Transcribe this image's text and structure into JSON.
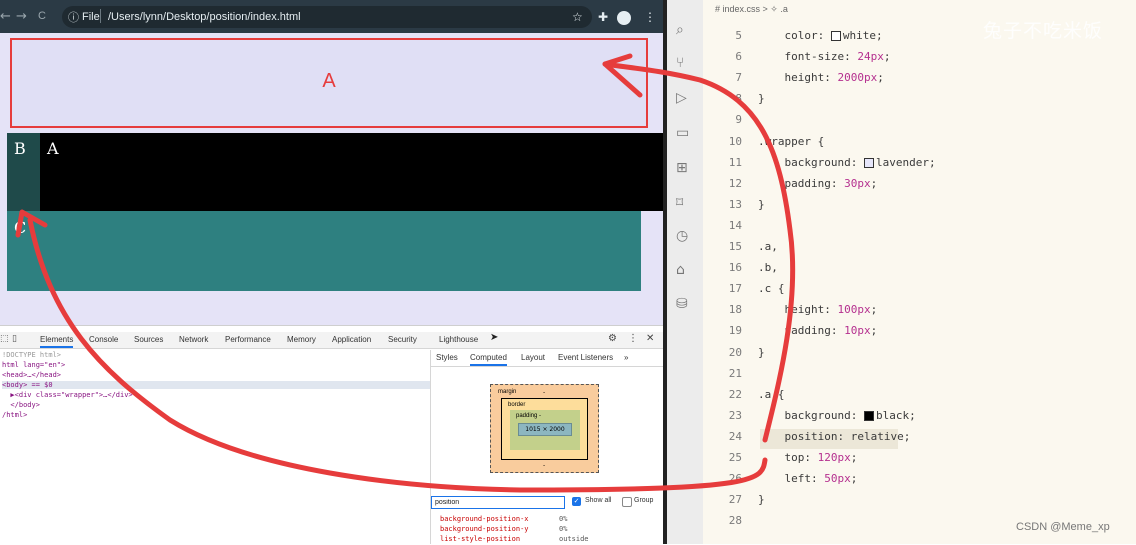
{
  "browser": {
    "nav_back": "←",
    "nav_forward": "→",
    "nav_reload": "C",
    "info_icon": "ⓘ",
    "file_label": "File",
    "url": "/Users/lynn/Desktop/position/index.html",
    "icons": [
      "star-icon",
      "extension-icon",
      "profile-icon",
      "more-icon"
    ]
  },
  "page": {
    "box_a_label": "A",
    "box_b_label": "B",
    "box_a2_label": "A",
    "box_c_label": "C"
  },
  "devtools": {
    "tabs": [
      "Elements",
      "Console",
      "Sources",
      "Network",
      "Performance",
      "Memory",
      "Application",
      "Security",
      "Lighthouse"
    ],
    "dom_lines": [
      "!DOCTYPE html>",
      "html lang=\"en\">",
      "<head>…</head>",
      "<body> == $0",
      "  ▶<div class=\"wrapper\">…</div>",
      "  </body>",
      "/html>"
    ],
    "styles_tabs": [
      "Styles",
      "Computed",
      "Layout",
      "Event Listeners",
      "»"
    ],
    "box_model": {
      "margin_label": "margin",
      "border_label": "border",
      "padding_label": "padding -",
      "content": "1015 × 2000",
      "dash": "-"
    },
    "filter_value": "position",
    "show_all_label": "Show all",
    "group_label": "Group",
    "properties": [
      {
        "name": "background-position-x",
        "value": "0%"
      },
      {
        "name": "background-position-y",
        "value": "0%"
      },
      {
        "name": "list-style-position",
        "value": "outside"
      }
    ]
  },
  "editor": {
    "tab_label": "# index.css > ✧ .a",
    "lines": [
      {
        "n": "5",
        "code": "    color: ",
        "tail": "white;",
        "swatch": "#ffffff"
      },
      {
        "n": "6",
        "code": "    font-size: ",
        "num": "24px",
        ";": ";"
      },
      {
        "n": "7",
        "code": "    height: ",
        "num": "2000px",
        ";": ";"
      },
      {
        "n": "8",
        "code": "}"
      },
      {
        "n": "9",
        "code": ""
      },
      {
        "n": "10",
        "code": ".wrapper {"
      },
      {
        "n": "11",
        "code": "    background: ",
        "tail": "lavender;",
        "swatch": "#e6e6fa"
      },
      {
        "n": "12",
        "code": "    padding: ",
        "num": "30px",
        ";": ";"
      },
      {
        "n": "13",
        "code": "}"
      },
      {
        "n": "14",
        "code": ""
      },
      {
        "n": "15",
        "code": ".a,"
      },
      {
        "n": "16",
        "code": ".b,"
      },
      {
        "n": "17",
        "code": ".c {"
      },
      {
        "n": "18",
        "code": "    height: ",
        "num": "100px",
        ";": ";"
      },
      {
        "n": "19",
        "code": "    padding: ",
        "num": "10px",
        ";": ";"
      },
      {
        "n": "20",
        "code": "}"
      },
      {
        "n": "21",
        "code": ""
      },
      {
        "n": "22",
        "code": ".a {"
      },
      {
        "n": "23",
        "code": "    background: ",
        "tail": "black;",
        "swatch": "#000000"
      },
      {
        "n": "24",
        "code": "    position: relative;"
      },
      {
        "n": "25",
        "code": "    top: ",
        "num": "120px",
        ";": ";"
      },
      {
        "n": "26",
        "code": "    left: ",
        "num": "50px",
        ";": ";"
      },
      {
        "n": "27",
        "code": "}"
      },
      {
        "n": "28",
        "code": ""
      }
    ]
  },
  "watermark_top": "兔子不吃米饭",
  "watermark_bottom": "CSDN @Meme_xp",
  "colors": {
    "annotation_red": "#e63c3c",
    "box_c": "#2e8080",
    "box_b": "#1f4a4a"
  }
}
